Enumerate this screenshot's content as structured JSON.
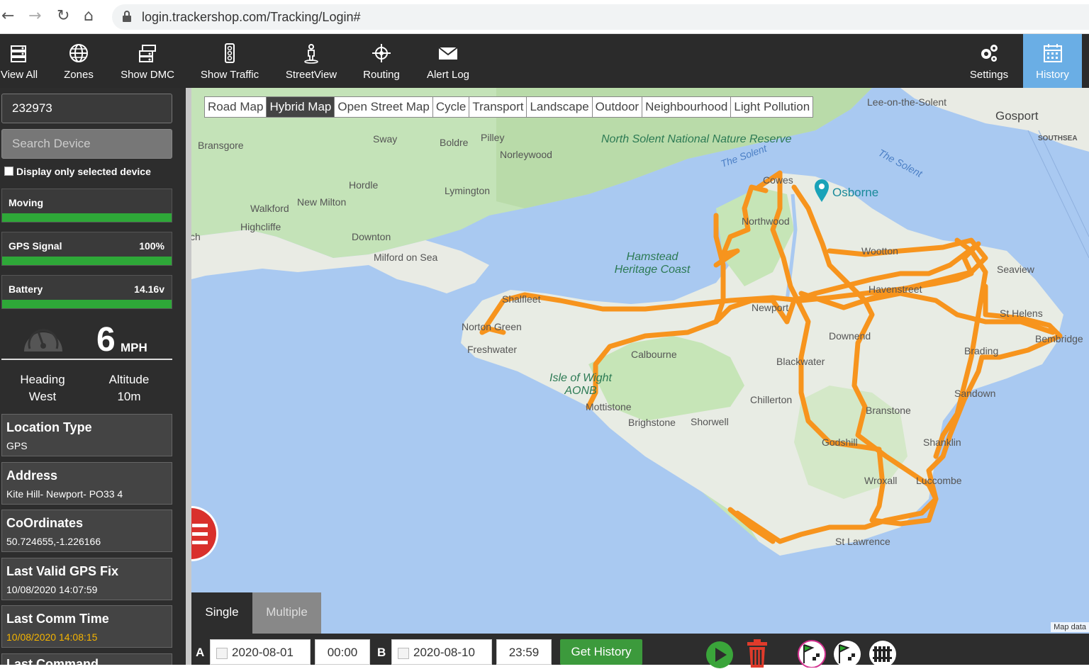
{
  "browser": {
    "url": "login.trackershop.com/Tracking/Login#"
  },
  "toolbar": {
    "items": [
      {
        "label": "View All",
        "icon": "view-all-icon"
      },
      {
        "label": "Zones",
        "icon": "globe-icon"
      },
      {
        "label": "Show DMC",
        "icon": "dmc-icon"
      },
      {
        "label": "Show Traffic",
        "icon": "traffic-light-icon"
      },
      {
        "label": "StreetView",
        "icon": "pegman-icon"
      },
      {
        "label": "Routing",
        "icon": "routing-icon"
      },
      {
        "label": "Alert Log",
        "icon": "envelope-icon"
      }
    ],
    "settings_label": "Settings",
    "history_label": "History"
  },
  "sidebar": {
    "device_id": "232973",
    "search_placeholder": "Search Device",
    "display_only_label": "Display only selected device",
    "moving_label": "Moving",
    "gps_label": "GPS Signal",
    "gps_value": "100%",
    "gps_level": 100,
    "battery_label": "Battery",
    "battery_value": "14.16v",
    "battery_level": 100,
    "speed": "6",
    "speed_unit": "MPH",
    "heading_label": "Heading",
    "heading_value": "West",
    "altitude_label": "Altitude",
    "altitude_value": "10m",
    "info": [
      {
        "title": "Location Type",
        "value": "GPS"
      },
      {
        "title": "Address",
        "value": "Kite Hill- Newport- PO33 4"
      },
      {
        "title": "CoOrdinates",
        "value": "50.724655,-1.226166"
      },
      {
        "title": "Last Valid GPS Fix",
        "value": "10/08/2020 14:07:59"
      },
      {
        "title": "Last Comm Time",
        "value": "10/08/2020 14:08:15"
      },
      {
        "title": "Last Command",
        "value": ""
      }
    ],
    "last_comm_color": "#f5b400"
  },
  "map": {
    "types": [
      "Road Map",
      "Hybrid Map",
      "Open Street Map",
      "Cycle",
      "Transport",
      "Landscape",
      "Outdoor",
      "Neighbourhood",
      "Light Pollution"
    ],
    "active_type": "Hybrid Map",
    "route_color": "#f7941d",
    "places": {
      "lee_on_the_solent": "Lee-on-the-Solent",
      "gosport": "Gosport",
      "southsea": "SOUTHSEA",
      "bransgore": "Bransgore",
      "sway": "Sway",
      "boldre": "Boldre",
      "pilley": "Pilley",
      "norleywood": "Norleywood",
      "hordle": "Hordle",
      "lymington": "Lymington",
      "walkford": "Walkford",
      "new_milton": "New Milton",
      "highcliffe": "Highcliffe",
      "downton": "Downton",
      "milford": "Milford on Sea",
      "osborne": "Osborne",
      "wootton": "Wootton",
      "seaview": "Seaview",
      "haven_street": "Havenstreet",
      "st_helens": "St Helens",
      "bembridge": "Bembridge",
      "brading": "Brading",
      "downend": "Downend",
      "blackwater": "Blackwater",
      "newport": "Newport",
      "norton_green": "Norton Green",
      "freshwater": "Freshwater",
      "shalfleet": "Shalfleet",
      "calbourne": "Calbourne",
      "mottistone": "Mottistone",
      "brighstone": "Brighstone",
      "shorwell": "Shorwell",
      "chillerton": "Chillerton",
      "branstone": "Branstone",
      "sandown": "Sandown",
      "shanklin": "Shanklin",
      "godshill": "Godshill",
      "wroxall": "Wroxall",
      "luccombe": "Luccombe",
      "st_lawrence": "St Lawrence",
      "cowes": "Cowes",
      "northwood": "Northwood",
      "ch": "ch"
    },
    "green_areas": {
      "north_solent": "North Solent National Nature Reserve",
      "hamstead": "Hamstead Heritage Coast",
      "aonb": "Isle of Wight AONB"
    },
    "water_labels": {
      "solent1": "The Solent",
      "solent2": "The Solent"
    },
    "map_data": "Map data"
  },
  "history": {
    "mode_single": "Single",
    "mode_multiple": "Multiple",
    "a_label": "A",
    "b_label": "B",
    "date_a": "2020-08-01",
    "time_a": "00:00",
    "date_b": "2020-08-10",
    "time_b": "23:59",
    "get_history": "Get History"
  }
}
